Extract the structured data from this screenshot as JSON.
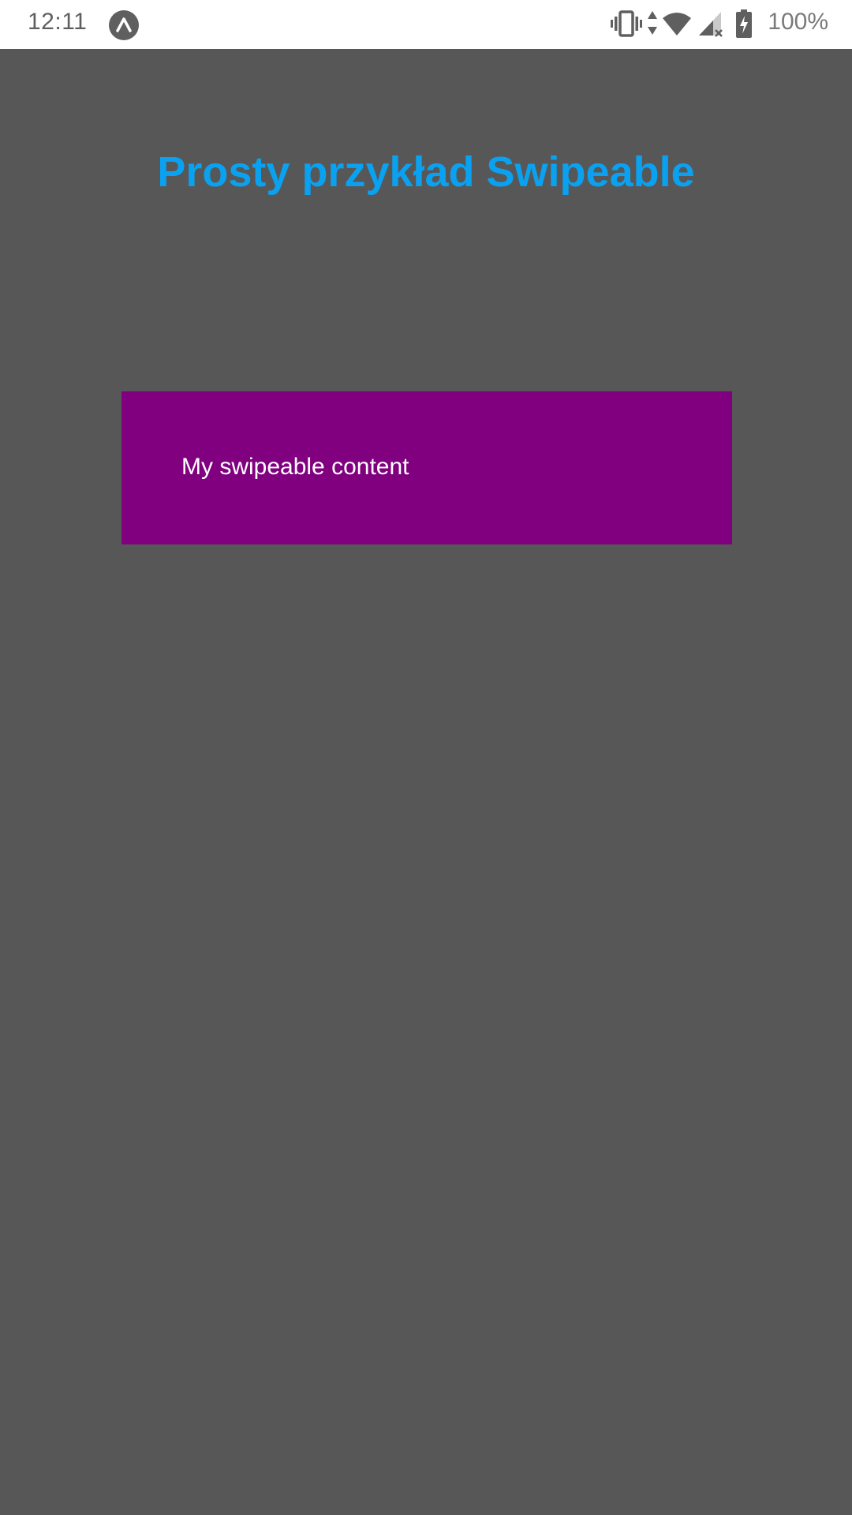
{
  "status_bar": {
    "time": "12:11",
    "battery_percent": "100%",
    "icons": [
      "expo-icon",
      "vibrate-icon",
      "data-arrows-icon",
      "wifi-icon",
      "cellular-no-signal-icon",
      "battery-charging-icon"
    ]
  },
  "main": {
    "title": "Prosty przykład Swipeable",
    "title_color": "#0aa1f0",
    "background_color": "#575757",
    "swipeable": {
      "label": "My swipeable content",
      "background_color": "#800080"
    }
  }
}
